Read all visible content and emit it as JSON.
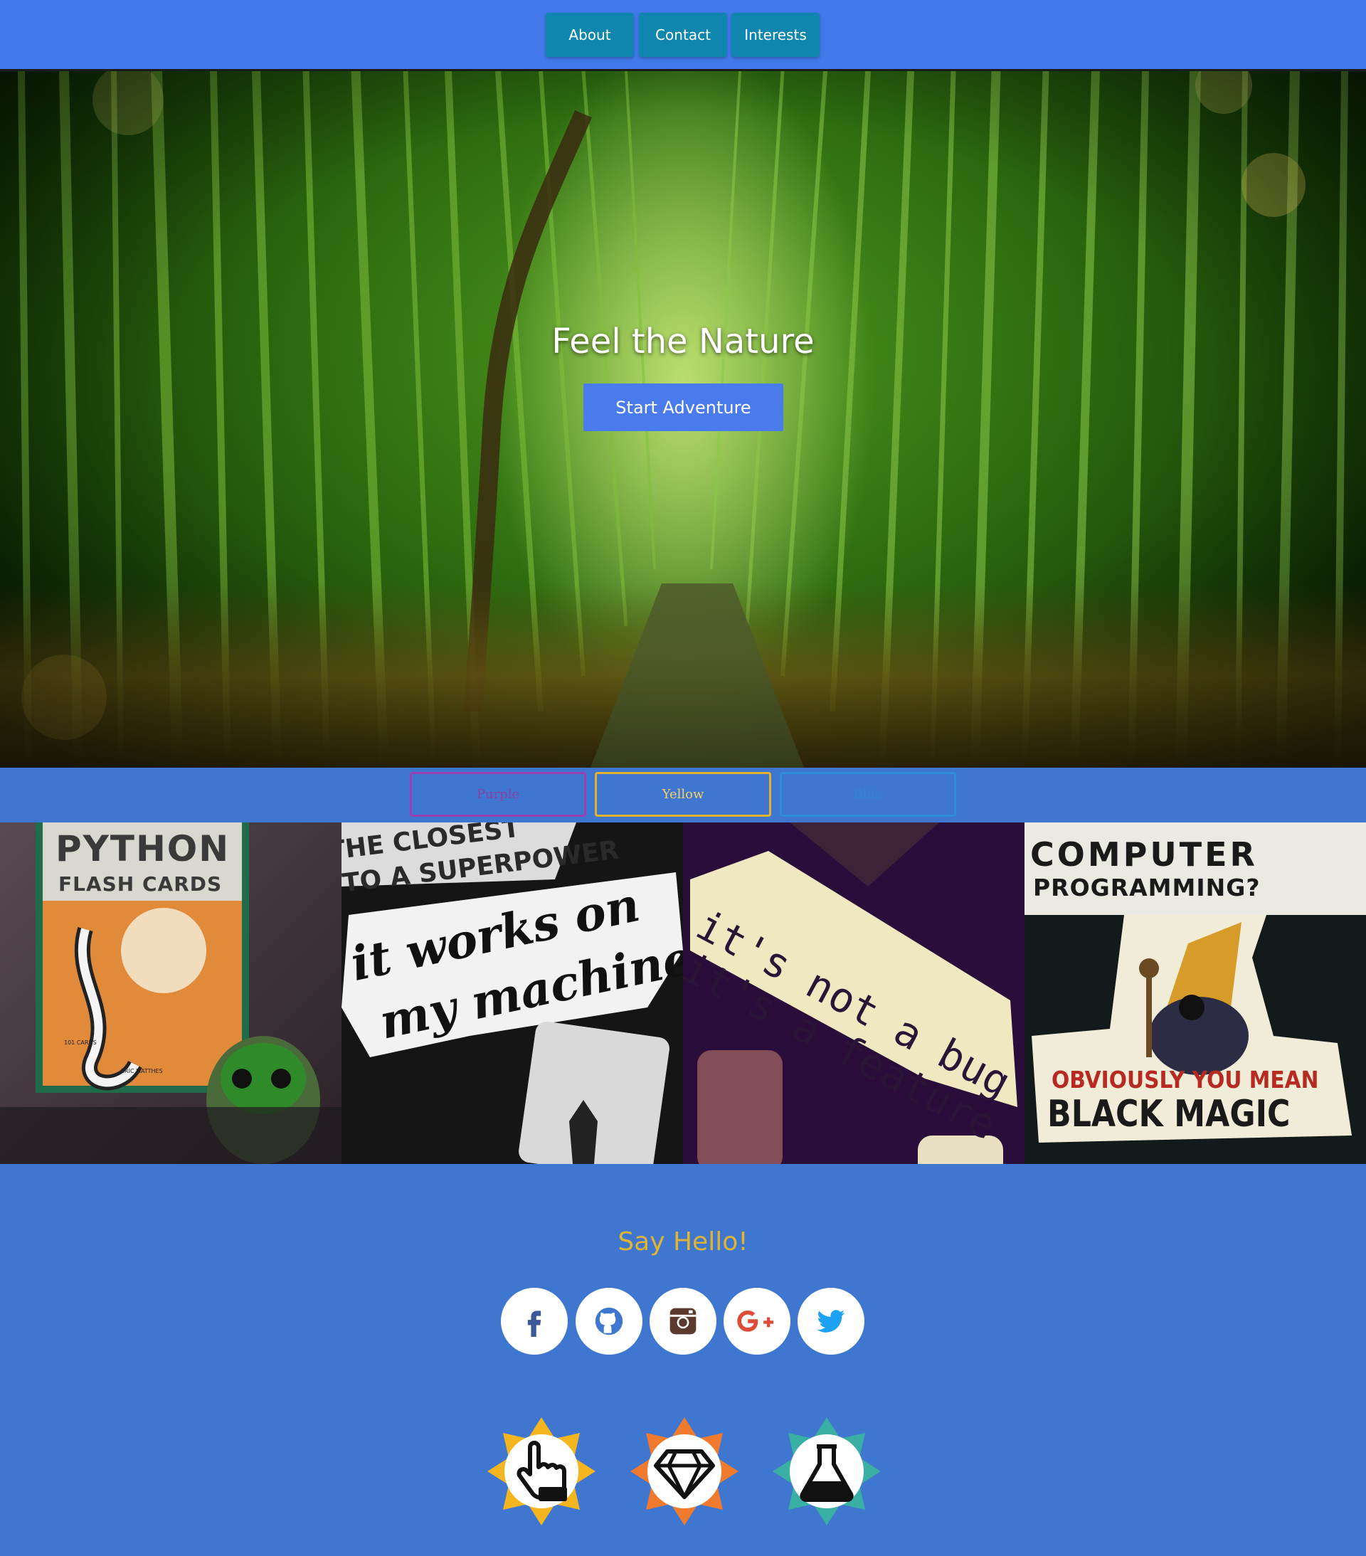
{
  "nav": {
    "about": "About",
    "contact": "Contact",
    "interests": "Interests"
  },
  "hero": {
    "title": "Feel the Nature",
    "button": "Start Adventure"
  },
  "filters": {
    "purple": "Purple",
    "yellow": "Yellow",
    "blue": "Blue"
  },
  "gallery": {
    "tile1": {
      "line1": "PYTHON",
      "line2": "FLASH CARDS",
      "small1": "101 CARDS",
      "small2": "ERIC MATTHES"
    },
    "tile2": {
      "top1": "THE CLOSEST",
      "top2": "TO A SUPERPOWER",
      "line1": "it works on",
      "line2": "my machine"
    },
    "tile3": {
      "line1": "it's not a bug",
      "line2": "it's a feature"
    },
    "tile4": {
      "line1": "COMPUTER",
      "line2": "PROGRAMMING?",
      "line3": "OBVIOUSLY YOU MEAN",
      "line4": "BLACK MAGIC"
    }
  },
  "contact": {
    "heading": "Say Hello!",
    "social": [
      {
        "name": "facebook-icon",
        "color": "#3b5998"
      },
      {
        "name": "github-icon",
        "color": "#3f77d0"
      },
      {
        "name": "instagram-icon",
        "color": "#5b3a2e"
      },
      {
        "name": "google-plus-icon",
        "color": "#dd4b39"
      },
      {
        "name": "twitter-icon",
        "color": "#1da1f2"
      }
    ]
  },
  "badges": [
    {
      "name": "pointer-hand-icon",
      "color": "#f5b51f"
    },
    {
      "name": "diamond-icon",
      "color": "#f07a2e"
    },
    {
      "name": "flask-icon",
      "color": "#3ab0a4"
    }
  ],
  "colors": {
    "nav": "#4379eb",
    "nav_button": "#0f86ad",
    "page_background": "#3f77d0",
    "hero_button": "#4a7bec",
    "heading_accent": "#e0b432"
  }
}
